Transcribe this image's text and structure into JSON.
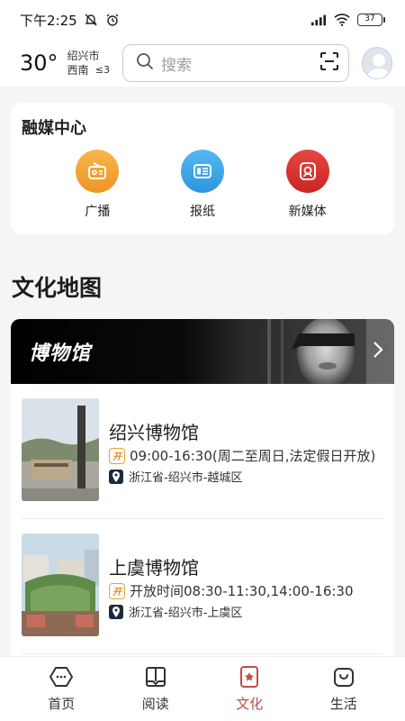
{
  "status_bar": {
    "time": "下午2:25",
    "battery": "37"
  },
  "header": {
    "temperature": "30°",
    "city": "绍兴市",
    "wind_direction": "西南",
    "wind_level": "≤3",
    "search_placeholder": "搜索"
  },
  "media_center": {
    "title": "融媒中心",
    "items": [
      {
        "label": "广播",
        "color": "#f2a23a"
      },
      {
        "label": "报纸",
        "color": "#3aa6e6"
      },
      {
        "label": "新媒体",
        "color": "#d8322e"
      }
    ]
  },
  "culture_map": {
    "title": "文化地图",
    "banner_title": "博物馆",
    "museums": [
      {
        "name": "绍兴博物馆",
        "hours": "09:00-16:30(周二至周日,法定假日开放)",
        "location": "浙江省-绍兴市-越城区"
      },
      {
        "name": "上虞博物馆",
        "hours": "开放时间08:30-11:30,14:00-16:30",
        "location": "浙江省-绍兴市-上虞区"
      }
    ]
  },
  "tab_bar": {
    "tabs": [
      {
        "label": "首页",
        "icon": "home-icon"
      },
      {
        "label": "阅读",
        "icon": "book-icon"
      },
      {
        "label": "文化",
        "icon": "culture-icon"
      },
      {
        "label": "生活",
        "icon": "life-icon"
      }
    ],
    "active_color": "#c4494a"
  }
}
